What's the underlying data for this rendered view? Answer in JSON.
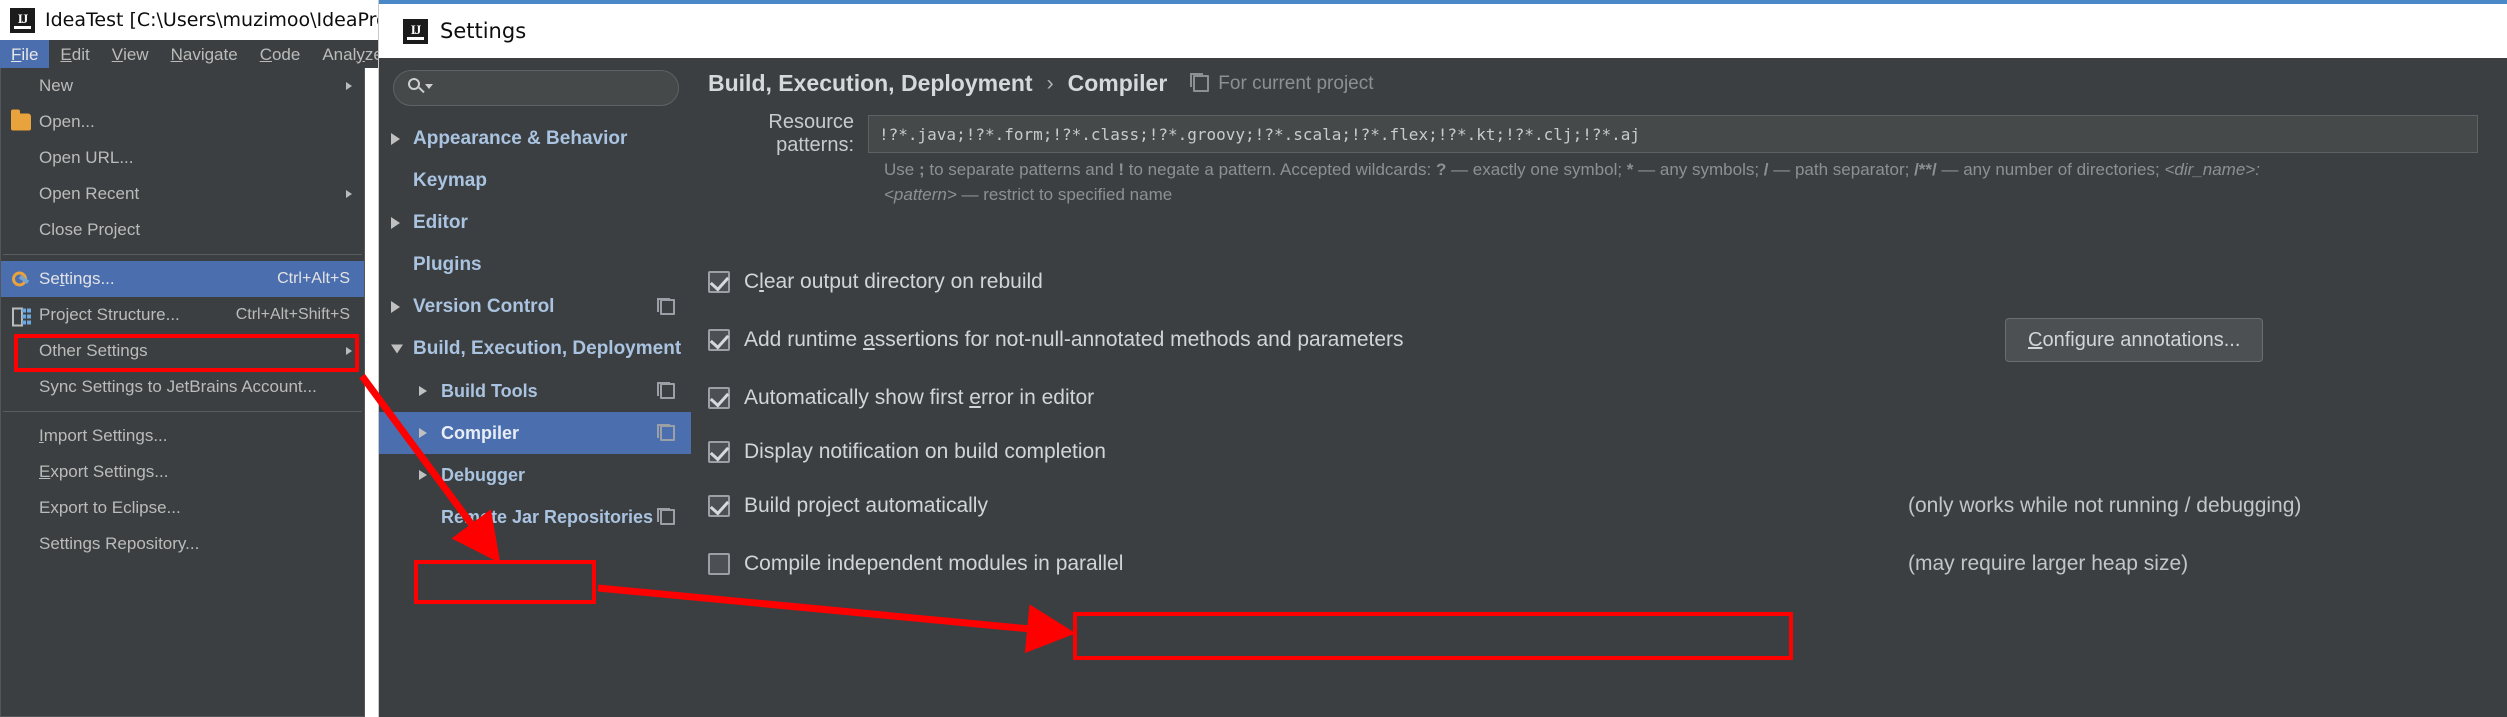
{
  "main_window": {
    "logo": "intellij-idea-logo",
    "title": "IdeaTest [C:\\Users\\muzimoo\\IdeaProjects\\",
    "menubar": [
      {
        "label": "File",
        "mnemonic": "F",
        "active": true
      },
      {
        "label": "Edit",
        "mnemonic": "E",
        "active": false
      },
      {
        "label": "View",
        "mnemonic": "V",
        "active": false
      },
      {
        "label": "Navigate",
        "mnemonic": "N",
        "active": false
      },
      {
        "label": "Code",
        "mnemonic": "C",
        "active": false
      },
      {
        "label": "Analyze",
        "mnemonic": "y",
        "active": false
      }
    ],
    "file_menu": [
      {
        "label": "New",
        "accel": "",
        "submenu": true,
        "icon": "",
        "selected": false
      },
      {
        "label": "Open...",
        "accel": "",
        "submenu": false,
        "icon": "folder-icon",
        "selected": false
      },
      {
        "label": "Open URL...",
        "accel": "",
        "submenu": false,
        "icon": "",
        "selected": false
      },
      {
        "label": "Open Recent",
        "accel": "",
        "submenu": true,
        "icon": "",
        "selected": false
      },
      {
        "label": "Close Project",
        "accel": "",
        "submenu": false,
        "icon": "",
        "selected": false
      },
      {
        "separator": true
      },
      {
        "label": "Settings...",
        "accel": "Ctrl+Alt+S",
        "submenu": false,
        "icon": "settings-wrench-icon",
        "selected": true
      },
      {
        "label": "Project Structure...",
        "accel": "Ctrl+Alt+Shift+S",
        "submenu": false,
        "icon": "project-structure-icon",
        "selected": false
      },
      {
        "label": "Other Settings",
        "accel": "",
        "submenu": true,
        "icon": "",
        "selected": false
      },
      {
        "label": "Sync Settings to JetBrains Account...",
        "accel": "",
        "submenu": false,
        "icon": "",
        "selected": false
      },
      {
        "separator": true
      },
      {
        "label": "Import Settings...",
        "accel": "",
        "submenu": false,
        "icon": "",
        "selected": false
      },
      {
        "label": "Export Settings...",
        "accel": "",
        "submenu": false,
        "icon": "",
        "selected": false
      },
      {
        "label": "Export to Eclipse...",
        "accel": "",
        "submenu": false,
        "icon": "",
        "selected": false
      },
      {
        "label": "Settings Repository...",
        "accel": "",
        "submenu": false,
        "icon": "",
        "selected": false
      }
    ]
  },
  "settings_dialog": {
    "title": "Settings",
    "logo": "intellij-idea-logo",
    "search": {
      "placeholder": "",
      "value": "",
      "icon": "search-icon"
    },
    "tree": [
      {
        "label": "Appearance & Behavior",
        "state": "collapsed",
        "depth": 0,
        "badge": false,
        "selected": false
      },
      {
        "label": "Keymap",
        "state": "leaf",
        "depth": 0,
        "badge": false,
        "selected": false
      },
      {
        "label": "Editor",
        "state": "collapsed",
        "depth": 0,
        "badge": false,
        "selected": false
      },
      {
        "label": "Plugins",
        "state": "leaf",
        "depth": 0,
        "badge": false,
        "selected": false
      },
      {
        "label": "Version Control",
        "state": "collapsed",
        "depth": 0,
        "badge": true,
        "selected": false
      },
      {
        "label": "Build, Execution, Deployment",
        "state": "expanded",
        "depth": 0,
        "badge": false,
        "selected": false
      },
      {
        "label": "Build Tools",
        "state": "collapsed",
        "depth": 1,
        "badge": true,
        "selected": false
      },
      {
        "label": "Compiler",
        "state": "collapsed",
        "depth": 1,
        "badge": true,
        "selected": true
      },
      {
        "label": "Debugger",
        "state": "collapsed",
        "depth": 1,
        "badge": false,
        "selected": false
      },
      {
        "label": "Remote Jar Repositories",
        "state": "leaf",
        "depth": 1,
        "badge": true,
        "selected": false
      }
    ],
    "breadcrumb": {
      "parent": "Build, Execution, Deployment",
      "separator": "›",
      "current": "Compiler",
      "scope": "For current project",
      "scope_icon": "copy-scope-icon"
    },
    "resource_patterns": {
      "label": "Resource patterns:",
      "value": "!?*.java;!?*.form;!?*.class;!?*.groovy;!?*.scala;!?*.flex;!?*.kt;!?*.clj;!?*.aj"
    },
    "hint": "Use ; to separate patterns and ! to negate a pattern. Accepted wildcards: ? — exactly one symbol; * — any symbols; / — path separator; /**/ — any number of directories; <dir_name>:<pattern> — restrict to specified name",
    "options": [
      {
        "label": "Clear output directory on rebuild",
        "mnemonic": "l",
        "checked": true,
        "note": "",
        "button": ""
      },
      {
        "label": "Add runtime assertions for not-null-annotated methods and parameters",
        "mnemonic": "a",
        "checked": true,
        "note": "",
        "button": "Configure annotations..."
      },
      {
        "label": "Automatically show first error in editor",
        "mnemonic": "e",
        "checked": true,
        "note": "",
        "button": ""
      },
      {
        "label": "Display notification on build completion",
        "mnemonic": "",
        "checked": true,
        "note": "",
        "button": ""
      },
      {
        "label": "Build project automatically",
        "mnemonic": "",
        "checked": true,
        "note": "(only works while not running / debugging)",
        "button": ""
      },
      {
        "label": "Compile independent modules in parallel",
        "mnemonic": "",
        "checked": false,
        "note": "(may require larger heap size)",
        "button": ""
      }
    ],
    "configure_annotations_button": "Configure annotations..."
  },
  "annotations": {
    "highlight_color": "#ff0000",
    "boxes": [
      "settings-menu-item",
      "compiler-tree-item",
      "build-project-automatically-option"
    ],
    "arrows": [
      "settings-to-compiler-arrow",
      "compiler-to-build-auto-arrow"
    ]
  },
  "colors": {
    "accent_blue": "#4b6eaf",
    "panel_bg": "#3c3f41",
    "field_bg": "#45494a",
    "text": "#bbbbbb",
    "tree_text": "#a9c3e0",
    "annotation_red": "#ff0000",
    "title_underline": "#4a88c7"
  }
}
